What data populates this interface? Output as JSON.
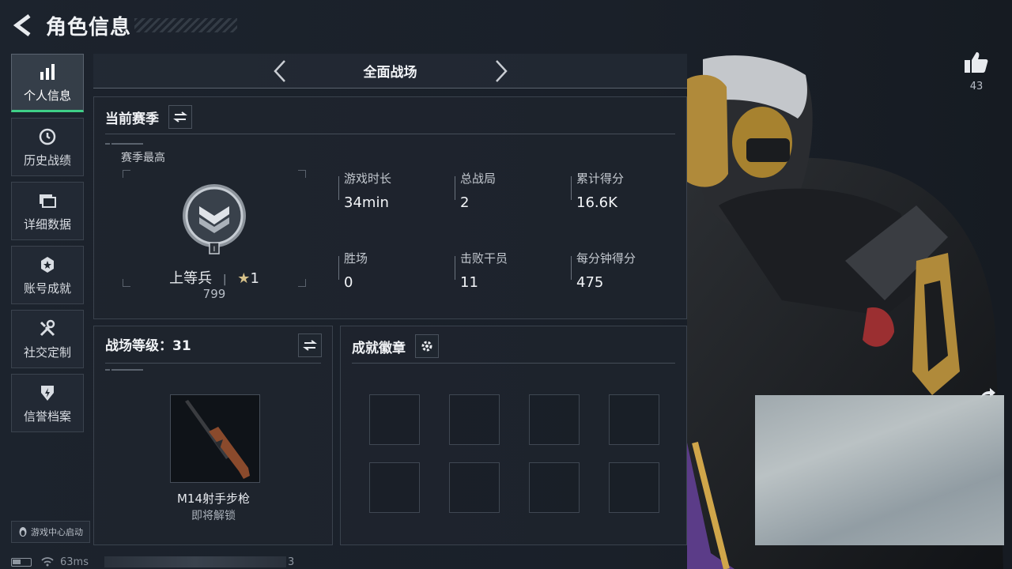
{
  "header": {
    "title": "角色信息"
  },
  "sidebar": {
    "items": [
      {
        "label": "个人信息",
        "icon": "bar-chart-icon",
        "active": true
      },
      {
        "label": "历史战绩",
        "icon": "clock-icon"
      },
      {
        "label": "详细数据",
        "icon": "folders-icon"
      },
      {
        "label": "账号成就",
        "icon": "achievement-icon"
      },
      {
        "label": "社交定制",
        "icon": "tools-icon"
      },
      {
        "label": "信誉档案",
        "icon": "shield-icon"
      }
    ],
    "launch_label": "游戏中心启动"
  },
  "mode": {
    "label": "全面战场"
  },
  "season": {
    "title": "当前赛季",
    "best_label": "赛季最高",
    "rank_name": "上等兵",
    "rank_stars": "1",
    "rank_badge_level": "I",
    "rank_score": "799",
    "stats": [
      {
        "key": "游戏时长",
        "value": "34min"
      },
      {
        "key": "总战局",
        "value": "2"
      },
      {
        "key": "累计得分",
        "value": "16.6K"
      },
      {
        "key": "胜场",
        "value": "0"
      },
      {
        "key": "击败干员",
        "value": "11"
      },
      {
        "key": "每分钟得分",
        "value": "475"
      }
    ]
  },
  "level": {
    "title": "战场等级：31",
    "weapon_name": "M14射手步枪",
    "weapon_status": "即将解锁"
  },
  "badges": {
    "title": "成就徽章",
    "slots": 8
  },
  "likes": {
    "count": "43"
  },
  "status": {
    "ping": "63ms",
    "tail": "3"
  },
  "colors": {
    "accent": "#3fcf87",
    "background": "#1b222c",
    "panel_border": "#3a424d"
  }
}
